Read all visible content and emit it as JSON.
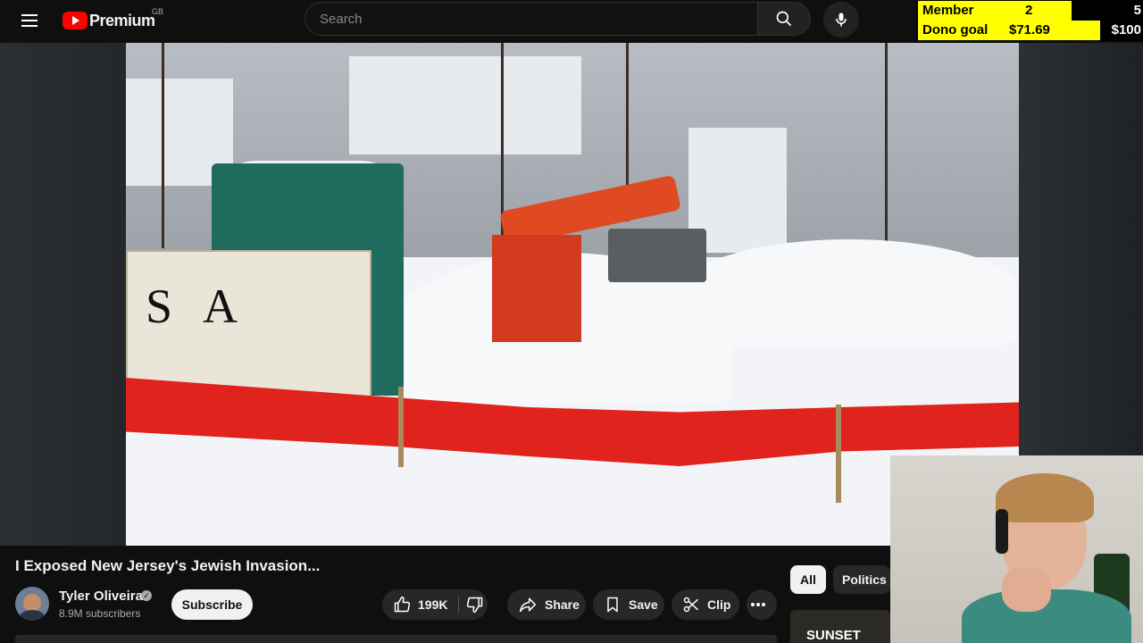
{
  "header": {
    "brand": "Premium",
    "region": "GB",
    "search_placeholder": "Search"
  },
  "stream_overlay": {
    "member_goal": {
      "label": "Member Goal",
      "current": "2",
      "max": "5",
      "progress": 0.4
    },
    "dono_goal": {
      "label": "Dono goal",
      "current": "$71.69",
      "max": "$100",
      "progress": 0.7169
    }
  },
  "video": {
    "title": "I Exposed New Jersey's Jewish Invasion..."
  },
  "channel": {
    "name": "Tyler Oliveira",
    "subscribers": "8.9M subscribers",
    "subscribe_label": "Subscribe"
  },
  "actions": {
    "likes": "199K",
    "share": "Share",
    "save": "Save",
    "clip": "Clip"
  },
  "sidebar": {
    "chips": [
      "All",
      "Politics N"
    ],
    "thumb_text": "SUNSET"
  },
  "colors": {
    "background": "#0f0f0f",
    "brand_red": "#ff0000",
    "goal_yellow": "#ffff00",
    "pill_bg": "#272727"
  },
  "icons": [
    "menu-icon",
    "youtube-logo-icon",
    "search-icon",
    "mic-icon",
    "verified-icon",
    "thumbs-up-icon",
    "thumbs-down-icon",
    "share-icon",
    "save-icon",
    "clip-icon",
    "more-icon"
  ]
}
